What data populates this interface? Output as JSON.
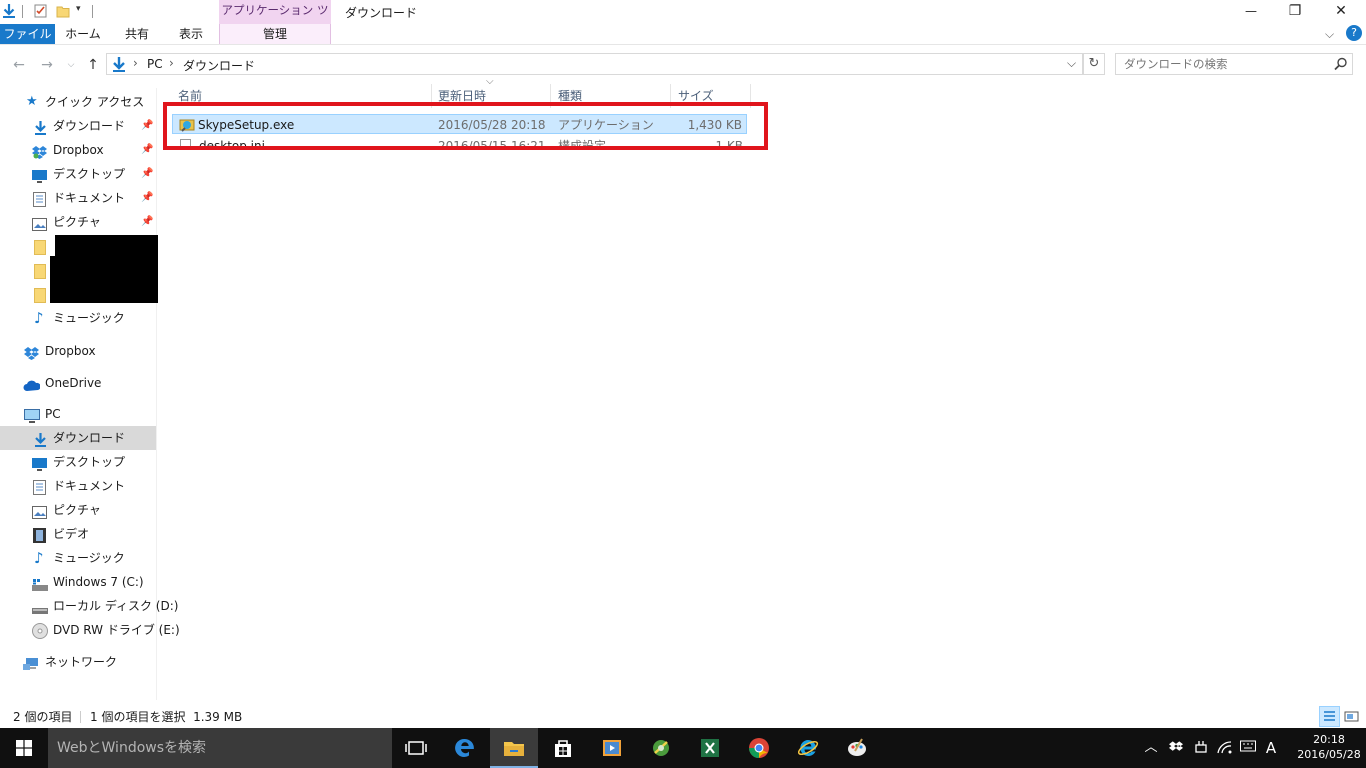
{
  "window": {
    "title": "ダウンロード",
    "context_tab_header": "アプリケーション ツール",
    "context_tab": "管理",
    "minimize": "—",
    "restore": "❐",
    "close": "✕"
  },
  "ribbon": {
    "tabs": [
      "ファイル",
      "ホーム",
      "共有",
      "表示"
    ],
    "expand": "⌵",
    "help": "?"
  },
  "address": {
    "crumbs": [
      "PC",
      "ダウンロード"
    ],
    "separator": "›",
    "dropdown": "⌵",
    "refresh": "↻",
    "search_placeholder": "ダウンロードの検索"
  },
  "nav": {
    "quick_access": "クイック アクセス",
    "quick_items": [
      {
        "label": "ダウンロード",
        "icon": "download-arrow-icon",
        "pinned": true
      },
      {
        "label": "Dropbox",
        "icon": "dropbox-icon",
        "pinned": true
      },
      {
        "label": "デスクトップ",
        "icon": "desktop-icon",
        "pinned": true
      },
      {
        "label": "ドキュメント",
        "icon": "document-icon",
        "pinned": true
      },
      {
        "label": "ピクチャ",
        "icon": "picture-icon",
        "pinned": true
      },
      {
        "label": "ミュージック",
        "icon": "music-icon",
        "pinned": false
      }
    ],
    "dropbox": "Dropbox",
    "onedrive": "OneDrive",
    "pc": "PC",
    "pc_items": [
      {
        "label": "ダウンロード",
        "icon": "download-arrow-icon",
        "selected": true
      },
      {
        "label": "デスクトップ",
        "icon": "desktop-icon"
      },
      {
        "label": "ドキュメント",
        "icon": "document-icon"
      },
      {
        "label": "ピクチャ",
        "icon": "picture-icon"
      },
      {
        "label": "ビデオ",
        "icon": "video-icon"
      },
      {
        "label": "ミュージック",
        "icon": "music-icon"
      },
      {
        "label": "Windows 7 (C:)",
        "icon": "drive-icon"
      },
      {
        "label": "ローカル ディスク (D:)",
        "icon": "drive-icon"
      },
      {
        "label": "DVD RW ドライブ (E:)",
        "icon": "dvd-icon"
      }
    ],
    "network": "ネットワーク",
    "pin_glyph": "📌"
  },
  "columns": {
    "name": "名前",
    "modified": "更新日時",
    "type": "種類",
    "size": "サイズ",
    "sort_indicator": "⌵"
  },
  "files": [
    {
      "name": "SkypeSetup.exe",
      "modified": "2016/05/28 20:18",
      "type": "アプリケーション",
      "size": "1,430 KB",
      "selected": true,
      "icon": "skype-setup-icon"
    },
    {
      "name": "desktop.ini",
      "modified": "2016/05/15 16:21",
      "type": "構成設定",
      "size": "1 KB",
      "selected": false,
      "icon": "ini-file-icon"
    }
  ],
  "status": {
    "item_count": "2 個の項目",
    "selection": "1 個の項目を選択  1.39 MB"
  },
  "taskbar": {
    "search_placeholder": "WebとWindowsを検索",
    "tray_chevron": "︿",
    "ime": "A",
    "time": "20:18",
    "date": "2016/05/28"
  },
  "colors": {
    "accent": "#1979ca",
    "selection": "#cce8ff",
    "highlight_box": "#e0151c",
    "taskbar": "#101010"
  }
}
